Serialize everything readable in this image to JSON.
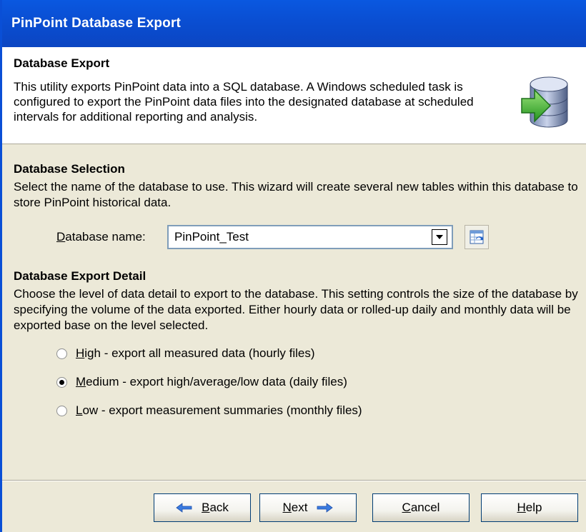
{
  "window": {
    "title": "PinPoint Database Export"
  },
  "header": {
    "title": "Database Export",
    "description": "This utility exports PinPoint data into a SQL database.  A Windows scheduled task is configured to export the PinPoint data files into the designated database at scheduled intervals for additional reporting and analysis."
  },
  "database_selection": {
    "title": "Database Selection",
    "description": "Select the name of the database to use.  This wizard will create several new tables within this database to store PinPoint historical data.",
    "label_prefix": "D",
    "label_rest": "atabase name:",
    "selected_database": "PinPoint_Test"
  },
  "export_detail": {
    "title": "Database Export Detail",
    "description": "Choose the level of data detail to export to the database.  This setting controls the size of the database by specifying the volume of the data exported.  Either hourly data or rolled-up daily and monthly data will be exported base on the level selected.",
    "options": [
      {
        "accel": "H",
        "rest": "igh - export all measured data (hourly files)",
        "checked": false
      },
      {
        "accel": "M",
        "rest": "edium - export high/average/low data (daily files)",
        "checked": true
      },
      {
        "accel": "L",
        "rest": "ow - export measurement summaries (monthly files)",
        "checked": false
      }
    ]
  },
  "buttons": {
    "back_accel": "B",
    "back_rest": "ack",
    "next_accel": "N",
    "next_rest": "ext",
    "cancel_accel": "C",
    "cancel_rest": "ancel",
    "help_accel": "H",
    "help_rest": "elp"
  },
  "colors": {
    "titlebar": "#0a4ed2",
    "arrow_blue": "#3a7be0",
    "arrow_green": "#3fb63a"
  }
}
